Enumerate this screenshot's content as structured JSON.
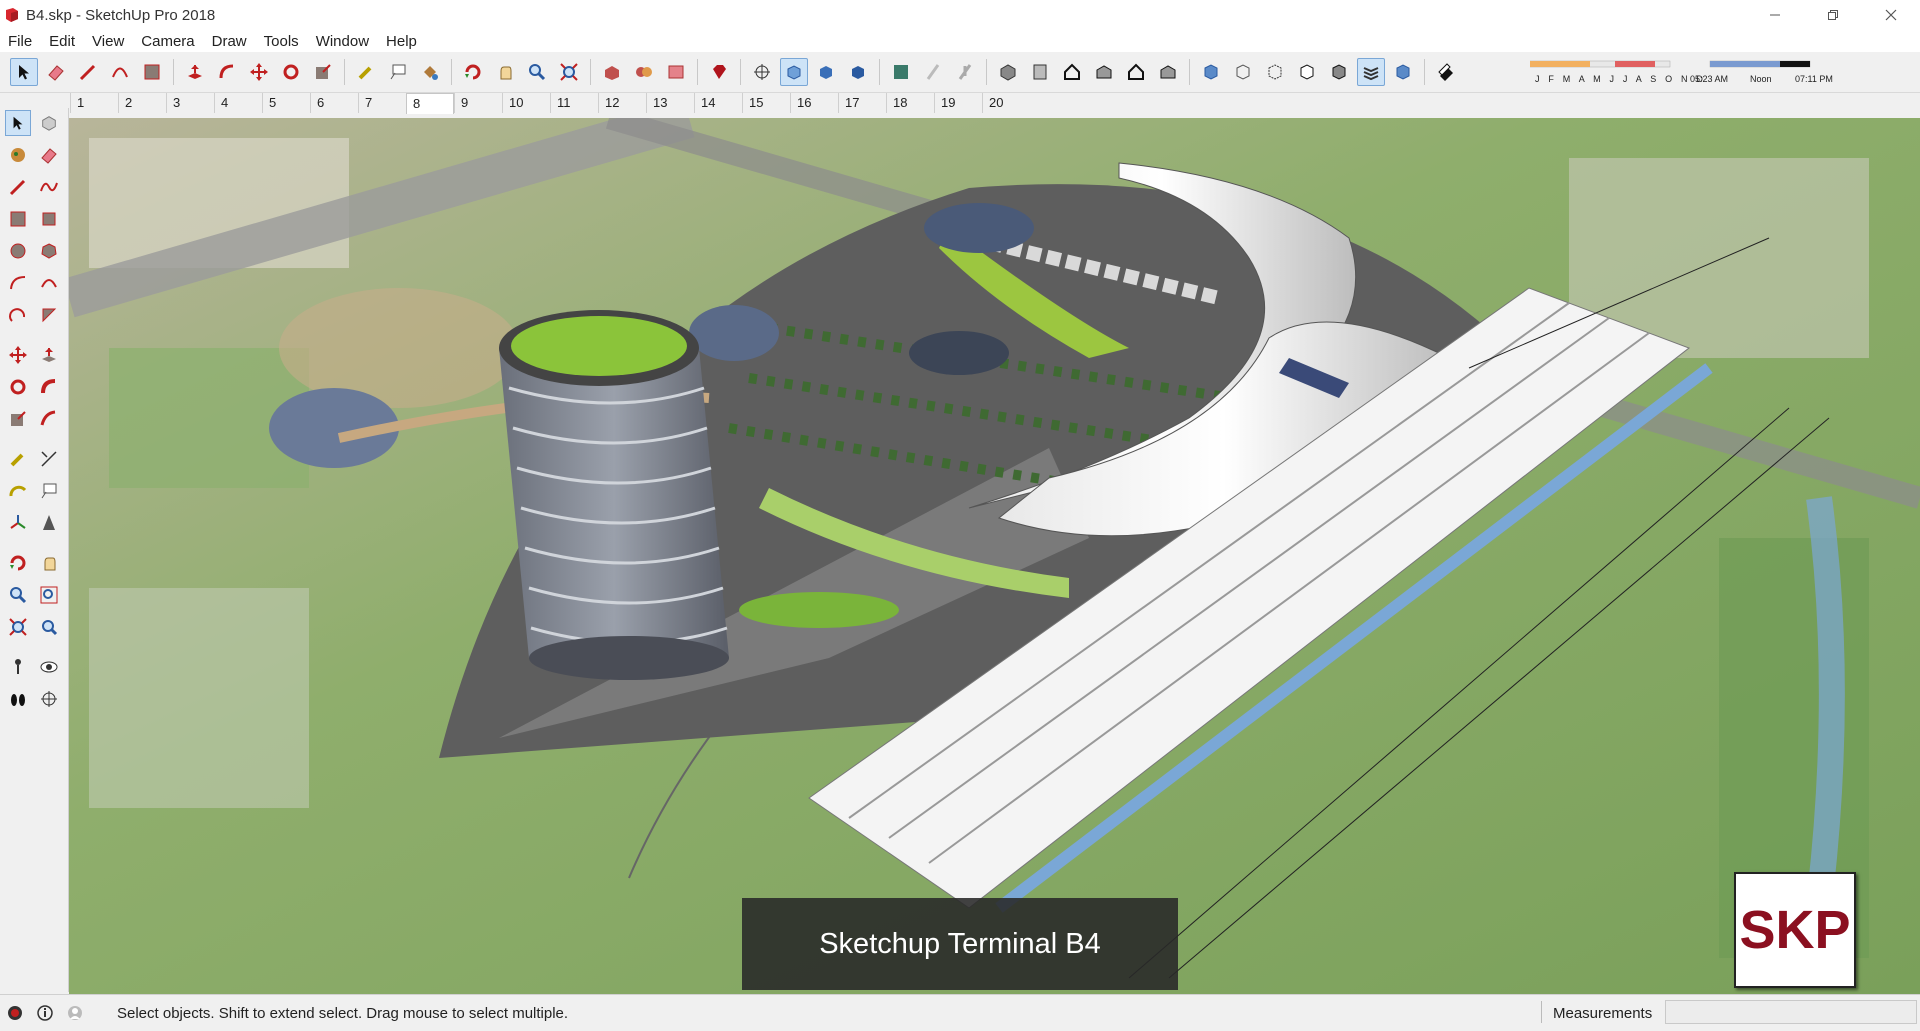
{
  "window": {
    "title": "B4.skp - SketchUp Pro 2018",
    "app_icon": "sketchup-logo-icon",
    "controls": [
      "minimize-icon",
      "restore-icon",
      "close-icon"
    ]
  },
  "menu": {
    "items": [
      "File",
      "Edit",
      "View",
      "Camera",
      "Draw",
      "Tools",
      "Window",
      "Help"
    ]
  },
  "toolbar": {
    "main_icons": [
      "select-icon",
      "eraser-icon",
      "line-icon",
      "arc-icon",
      "rectangle-icon",
      "push-pull-icon",
      "follow-me-icon",
      "move-icon",
      "rotate-icon",
      "scale-icon",
      "tape-measure-icon",
      "text-icon",
      "paint-bucket-icon",
      "orbit-icon",
      "pan-icon",
      "zoom-icon",
      "zoom-extents-icon",
      "warehouse-icon",
      "extension-warehouse-icon",
      "layout-icon",
      "ruby-icon",
      "section-plane-icon",
      "x-ray-icon",
      "back-edges-icon",
      "wireframe-icon",
      "hidden-line-icon",
      "shaded-icon",
      "iso-view-icon",
      "top-view-icon",
      "front-view-icon",
      "right-view-icon",
      "back-view-icon",
      "left-view-icon",
      "style-xray-icon",
      "style-backedges-icon",
      "style-wireframe-icon",
      "style-hidden-icon",
      "style-shaded-icon",
      "style-textured-icon",
      "style-monochrome-icon",
      "shadows-icon"
    ],
    "shadow_months": "J F M A M J J A S O N D",
    "shadow_times": [
      "05:23 AM",
      "Noon",
      "07:11 PM"
    ]
  },
  "scenes": {
    "tabs": [
      "1",
      "2",
      "3",
      "4",
      "5",
      "6",
      "7",
      "8",
      "9",
      "10",
      "11",
      "12",
      "13",
      "14",
      "15",
      "16",
      "17",
      "18",
      "19",
      "20"
    ],
    "active": "8"
  },
  "left_tools": [
    "select-icon",
    "make-component-icon",
    "paint-bucket-icon",
    "eraser-icon",
    "line-icon",
    "freehand-icon",
    "rectangle-icon",
    "rotated-rectangle-icon",
    "circle-icon",
    "polygon-icon",
    "arc-icon",
    "two-point-arc-icon",
    "three-point-arc-icon",
    "pie-icon",
    "move-icon",
    "push-pull-icon",
    "rotate-icon",
    "follow-me-icon",
    "scale-icon",
    "offset-icon",
    "tape-measure-icon",
    "dimension-icon",
    "protractor-icon",
    "text-icon",
    "axes-icon",
    "3d-text-icon",
    "orbit-icon",
    "pan-icon",
    "zoom-icon",
    "zoom-window-icon",
    "zoom-extents-icon",
    "previous-view-icon",
    "position-camera-icon",
    "look-around-icon",
    "walk-icon",
    "section-plane-icon"
  ],
  "viewport": {
    "caption": "Sketchup Terminal B4",
    "logo_text": "SKP"
  },
  "status": {
    "icons": [
      "geo-location-icon",
      "credits-icon",
      "user-icon"
    ],
    "message": "Select objects. Shift to extend select. Drag mouse to select multiple.",
    "measurements_label": "Measurements",
    "measurements_value": ""
  },
  "colors": {
    "caption_bg": "#282828",
    "logo_text": "#8b1020",
    "active_tool_bg": "#cde3f7"
  }
}
